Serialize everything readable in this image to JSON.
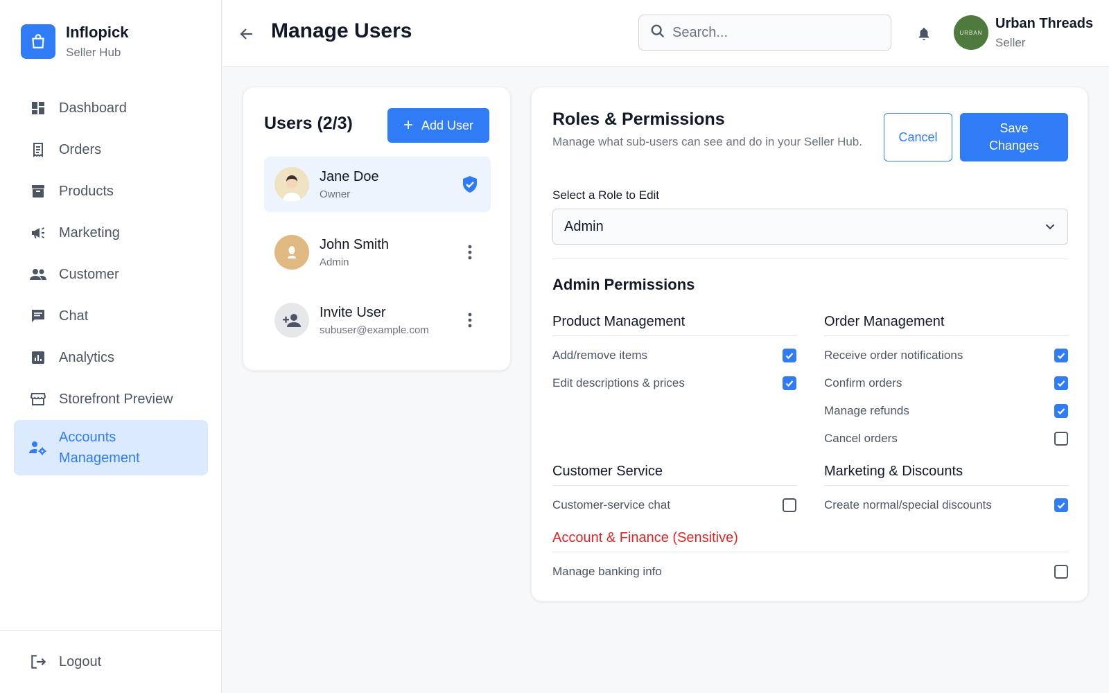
{
  "brand": {
    "name": "Inflopick",
    "subtitle": "Seller Hub"
  },
  "sidebar": {
    "items": [
      {
        "label": "Dashboard",
        "icon": "dashboard-icon"
      },
      {
        "label": "Orders",
        "icon": "receipt-icon"
      },
      {
        "label": "Products",
        "icon": "archive-box-icon"
      },
      {
        "label": "Marketing",
        "icon": "megaphone-icon"
      },
      {
        "label": "Customer",
        "icon": "people-icon"
      },
      {
        "label": "Chat",
        "icon": "chat-bubble-icon"
      },
      {
        "label": "Analytics",
        "icon": "bar-chart-icon"
      },
      {
        "label": "Storefront Preview",
        "icon": "storefront-icon"
      },
      {
        "label": "Accounts Management",
        "icon": "user-settings-icon",
        "active": true
      }
    ],
    "logout_label": "Logout"
  },
  "header": {
    "title": "Manage Users",
    "search_placeholder": "Search...",
    "profile": {
      "name": "Urban Threads",
      "role": "Seller",
      "avatar_text": "URBAN"
    }
  },
  "users": {
    "title": "Users (2/3)",
    "add_label": "Add User",
    "list": [
      {
        "name": "Jane Doe",
        "role": "Owner",
        "selected": true
      },
      {
        "name": "John Smith",
        "role": "Admin"
      },
      {
        "name": "Invite User",
        "role": "subuser@example.com"
      }
    ]
  },
  "roles": {
    "title": "Roles & Permissions",
    "description": "Manage what sub-users can see and do in your Seller Hub.",
    "cancel_label": "Cancel",
    "save_label": "Save Changes",
    "select_label": "Select a Role to Edit",
    "selected_role": "Admin",
    "permissions_title": "Admin Permissions",
    "sections": {
      "product": {
        "title": "Product Management",
        "items": [
          {
            "label": "Add/remove items",
            "checked": true
          },
          {
            "label": "Edit descriptions & prices",
            "checked": true
          }
        ]
      },
      "order": {
        "title": "Order Management",
        "items": [
          {
            "label": "Receive order notifications",
            "checked": true
          },
          {
            "label": "Confirm orders",
            "checked": true
          },
          {
            "label": "Manage refunds",
            "checked": true
          },
          {
            "label": "Cancel orders",
            "checked": false
          }
        ]
      },
      "customer": {
        "title": "Customer Service",
        "items": [
          {
            "label": "Customer-service chat",
            "checked": false
          }
        ]
      },
      "marketing": {
        "title": "Marketing & Discounts",
        "items": [
          {
            "label": "Create normal/special discounts",
            "checked": true
          }
        ]
      },
      "finance": {
        "title": "Account & Finance (Sensitive)",
        "items": [
          {
            "label": "Manage banking info",
            "checked": false
          }
        ]
      }
    }
  },
  "colors": {
    "accent": "#2f7cf6",
    "danger": "#dc2626",
    "active_bg": "#dbeafe"
  }
}
